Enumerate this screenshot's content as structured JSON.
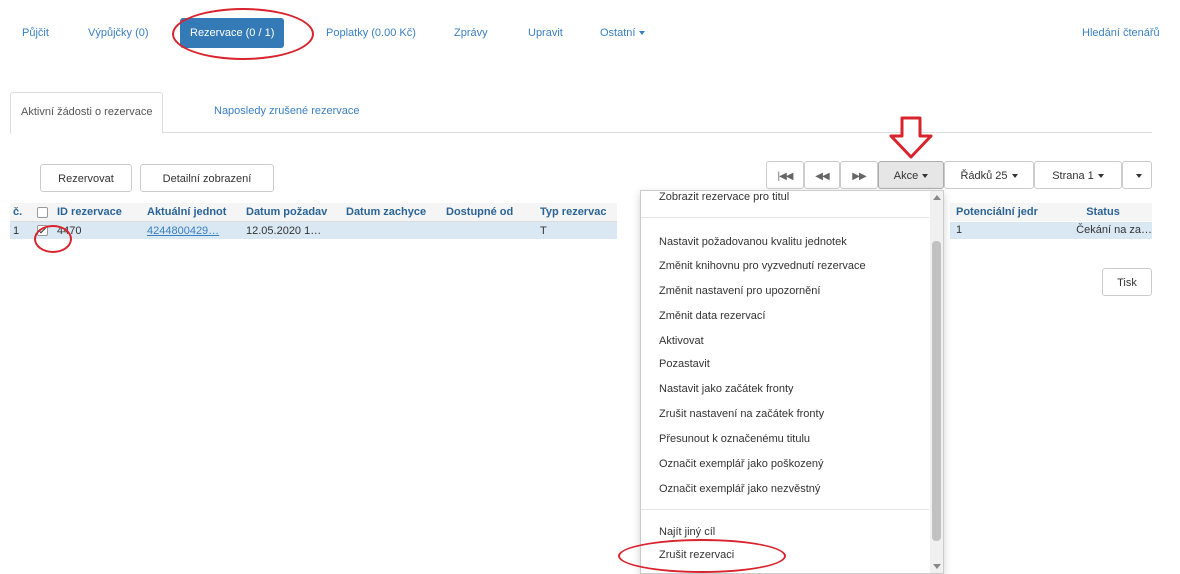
{
  "topnav": {
    "items": [
      {
        "label": "Půjčit"
      },
      {
        "label": "Výpůjčky (0)"
      },
      {
        "label": "Rezervace (0 / 1)"
      },
      {
        "label": "Poplatky (0.00 Kč)"
      },
      {
        "label": "Zprávy"
      },
      {
        "label": "Upravit"
      },
      {
        "label": "Ostatní"
      }
    ],
    "right_link": "Hledání čtenářů"
  },
  "tabs": [
    {
      "label": "Aktivní žádosti o rezervace"
    },
    {
      "label": "Naposledy zrušené rezervace"
    }
  ],
  "toolbar": {
    "reserve": "Rezervovat",
    "detail": "Detailní zobrazení",
    "actions": "Akce",
    "rows": "Řádků 25",
    "page": "Strana 1"
  },
  "table": {
    "headers": [
      "č.",
      "",
      "ID rezervace",
      "Aktuální jednot",
      "Datum požadav",
      "Datum zachyce",
      "Dostupné od",
      "Typ rezervac"
    ],
    "row": [
      "1",
      "",
      "4470",
      "4244800429…",
      "12.05.2020 1…",
      "",
      "",
      "T"
    ],
    "right_headers": [
      "Potenciální jedr",
      "Status"
    ],
    "right_row": [
      "1",
      "Čekání na za…"
    ]
  },
  "print_button": "Tisk",
  "menu": {
    "top_item": "Zobrazit rezervace pro titul",
    "items": [
      "Nastavit požadovanou kvalitu jednotek",
      "Změnit knihovnu pro vyzvednutí rezervace",
      "Změnit nastavení pro upozornění",
      "Změnit data rezervací",
      "Aktivovat",
      "Pozastavit",
      "Nastavit jako začátek fronty",
      "Zrušit nastavení na začátek fronty",
      "Přesunout k označenému titulu",
      "Označit exemplář jako poškozený",
      "Označit exemplář jako nezvěstný"
    ],
    "bottom_items": [
      "Najít jiný cíl",
      "Zrušit rezervaci"
    ]
  },
  "colors": {
    "accent": "#337ab7",
    "link": "#3a7fc2",
    "annotation": "#d9232d",
    "selected_row": "#d9e8f3"
  }
}
